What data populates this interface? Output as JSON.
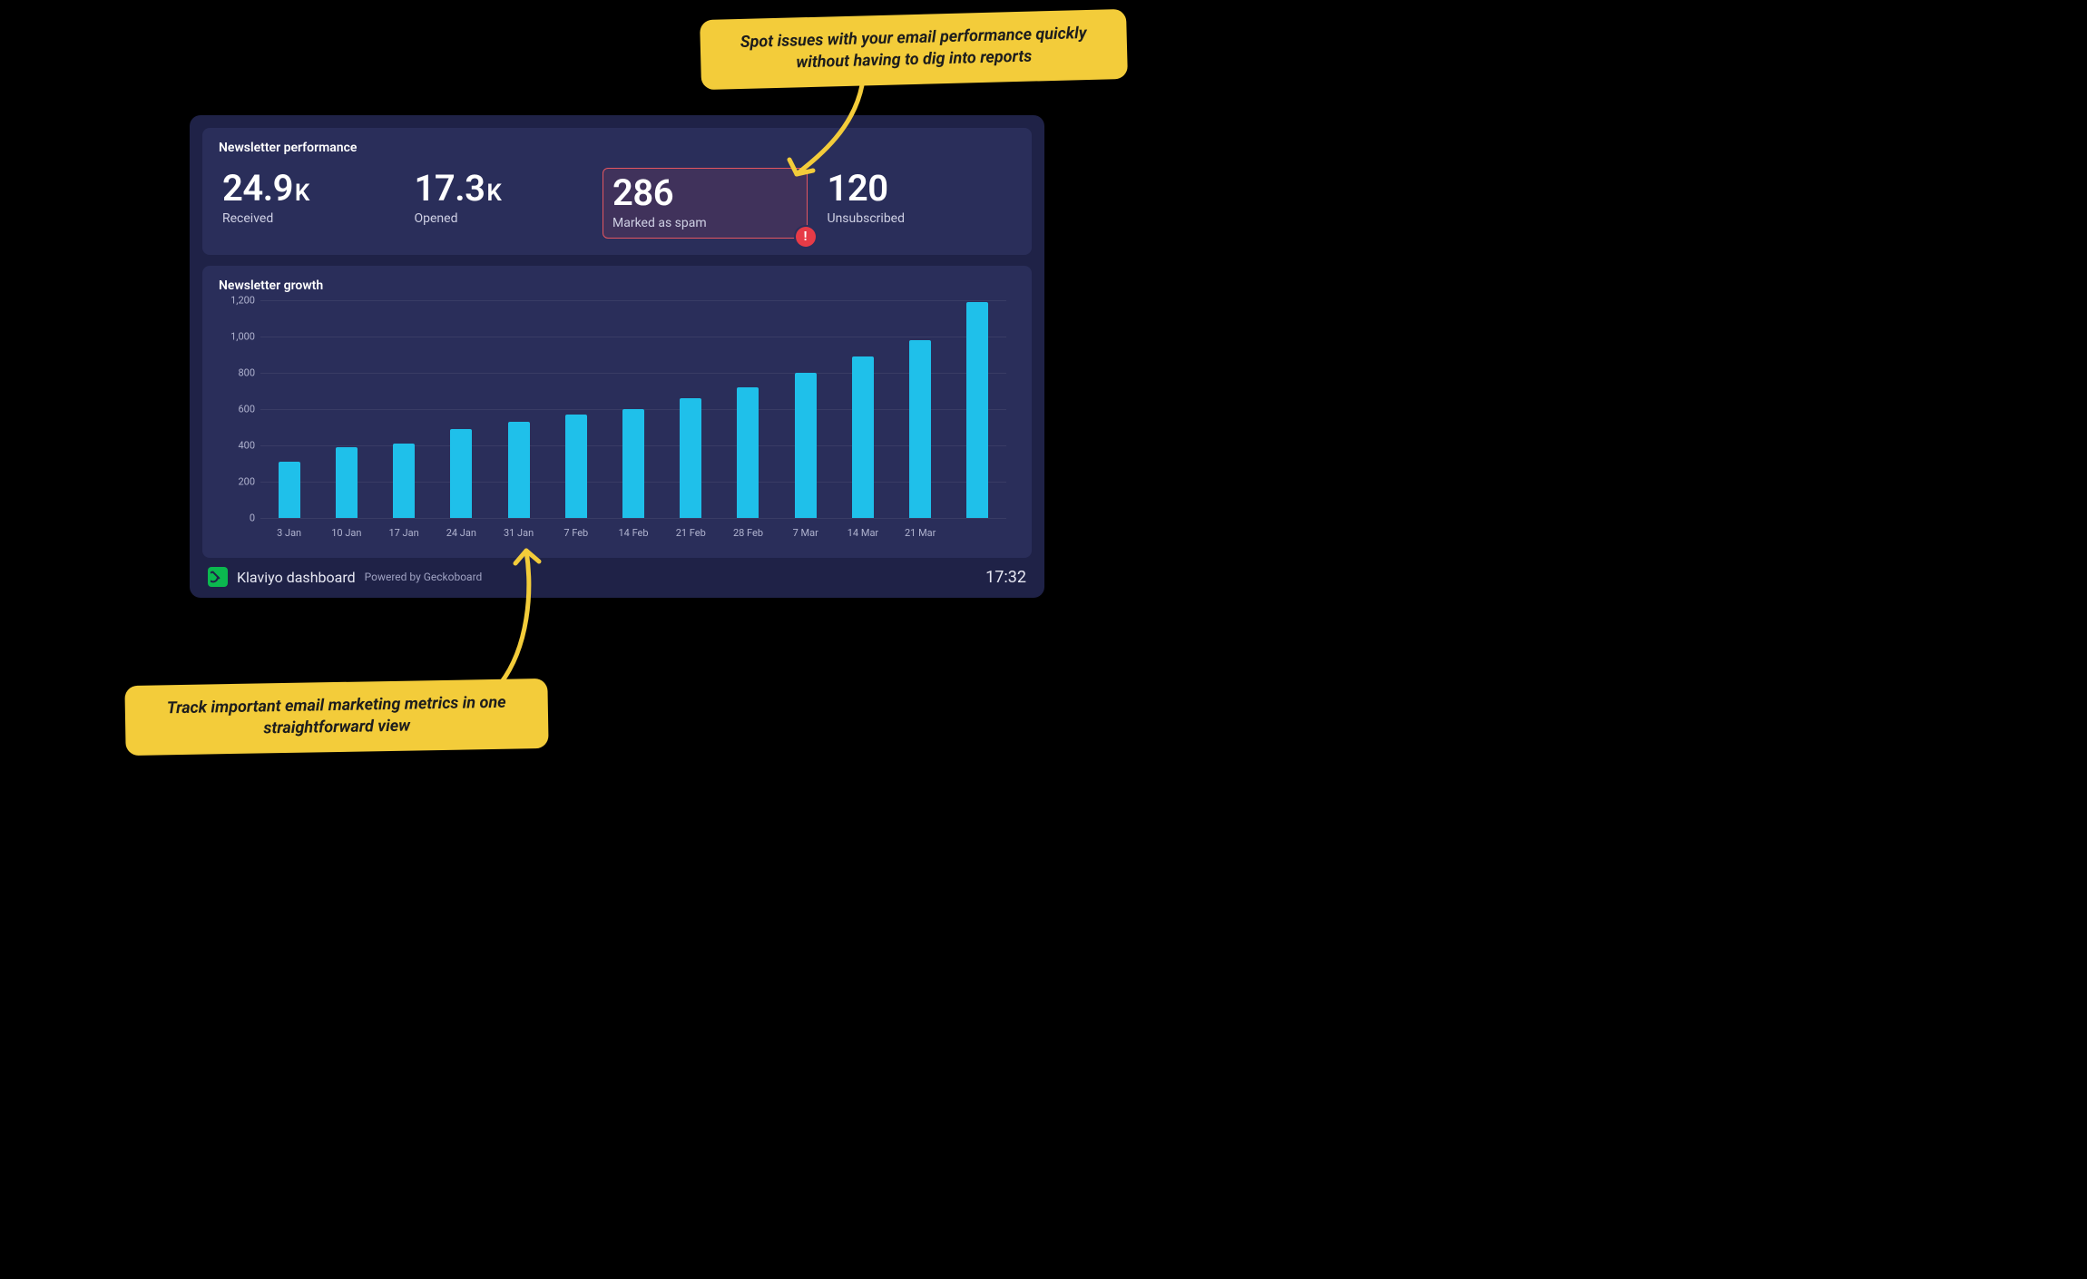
{
  "dashboard": {
    "performance": {
      "title": "Newsletter performance",
      "metrics": {
        "received": {
          "value": "24.9",
          "suffix": "K",
          "label": "Received"
        },
        "opened": {
          "value": "17.3",
          "suffix": "K",
          "label": "Opened"
        },
        "spam": {
          "value": "286",
          "label": "Marked as spam"
        },
        "unsub": {
          "value": "120",
          "label": "Unsubscribed"
        }
      }
    },
    "growth": {
      "title": "Newsletter growth"
    },
    "footer": {
      "title": "Klaviyo dashboard",
      "powered": "Powered by Geckoboard",
      "time": "17:32"
    }
  },
  "callouts": {
    "top": "Spot issues with your email performance quickly without having to dig into reports",
    "bottom": "Track important email marketing metrics in one straightforward view"
  },
  "chart_data": {
    "type": "bar",
    "title": "Newsletter growth",
    "xlabel": "",
    "ylabel": "",
    "ylim": [
      0,
      1200
    ],
    "y_ticks": [
      0,
      200,
      400,
      600,
      800,
      1000,
      1200
    ],
    "y_tick_labels": [
      "0",
      "200",
      "400",
      "600",
      "800",
      "1,000",
      "1,200"
    ],
    "categories": [
      "3 Jan",
      "10 Jan",
      "17 Jan",
      "24 Jan",
      "31 Jan",
      "7 Feb",
      "14 Feb",
      "21 Feb",
      "28 Feb",
      "7 Mar",
      "14 Mar",
      "21 Mar",
      ""
    ],
    "values": [
      310,
      390,
      410,
      490,
      530,
      570,
      600,
      660,
      720,
      800,
      890,
      980,
      1190
    ],
    "bar_color": "#1fc0ea"
  }
}
